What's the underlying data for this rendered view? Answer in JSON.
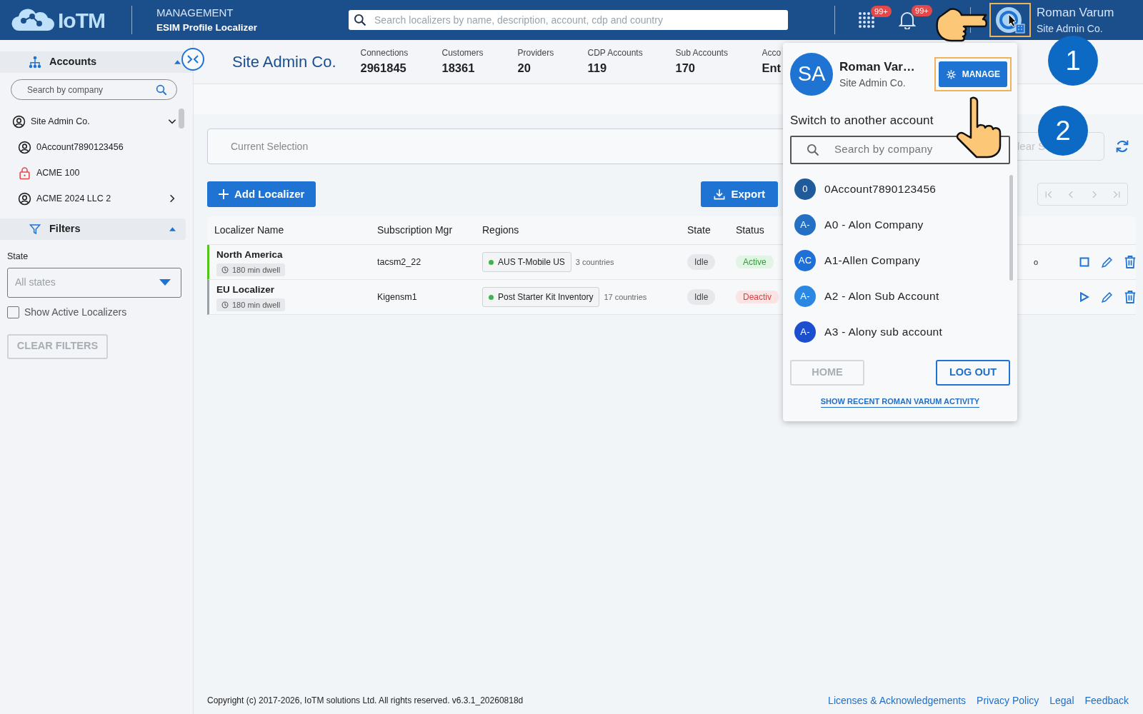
{
  "header": {
    "logo": "IoTM",
    "section": "MANAGEMENT",
    "page": "ESIM Profile Localizer",
    "search_placeholder": "Search localizers by name, description, account, cdp and country",
    "apps_badge": "99+",
    "notifications_badge": "99+",
    "user_name": "Roman Varum",
    "user_account": "Site Admin Co."
  },
  "sidebar": {
    "accounts_title": "Accounts",
    "accounts_expanded": true,
    "search_placeholder": "Search by company",
    "tree": [
      {
        "label": "Site Admin Co.",
        "kind": "account",
        "expanded": true,
        "children": [
          {
            "label": "0Account7890123456",
            "kind": "account"
          },
          {
            "label": "ACME 100",
            "kind": "locked"
          },
          {
            "label": "ACME 2024 LLC 2",
            "kind": "account",
            "expanded": false
          }
        ]
      }
    ],
    "filters_title": "Filters",
    "filters_expanded": true,
    "state_label": "State",
    "state_placeholder": "All states",
    "show_active": {
      "label": "Show Active Localizers",
      "checked": false
    },
    "clear_filters": {
      "label": "CLEAR FILTERS",
      "disabled": true
    }
  },
  "summary": {
    "title": "Site Admin Co.",
    "stats": [
      {
        "label": "Connections",
        "value": "2961845"
      },
      {
        "label": "Customers",
        "value": "18361"
      },
      {
        "label": "Providers",
        "value": "20"
      },
      {
        "label": "CDP Accounts",
        "value": "119"
      },
      {
        "label": "Sub Accounts",
        "value": "170"
      },
      {
        "label": "Acco",
        "value": "Ent"
      }
    ]
  },
  "selection": {
    "placeholder": "Current Selection",
    "clear_label": "lear S"
  },
  "toolbar": {
    "add": "Add Localizer",
    "export": "Export"
  },
  "table": {
    "columns": [
      "Localizer Name",
      "Subscription Mgr",
      "Regions",
      "State",
      "Status"
    ],
    "rows": [
      {
        "name": "North America",
        "dwell": "180 min dwell",
        "subscription_mgr": "tacsm2_22",
        "region": "AUS T-Mobile US",
        "region_count": "3 countries",
        "state": "Idle",
        "status": "Active",
        "active": true,
        "column_6": "o",
        "running": true
      },
      {
        "name": "EU Localizer",
        "dwell": "180 min dwell",
        "subscription_mgr": "Kigensm1",
        "region": "Post Starter Kit Inventory",
        "region_count": "17 countries",
        "state": "Idle",
        "status": "Deactiv",
        "active": false,
        "running": false
      }
    ]
  },
  "account_menu": {
    "initials": "SA",
    "name": "Roman Var…",
    "account": "Site Admin Co.",
    "manage": "MANAGE",
    "switch_title": "Switch to another account",
    "search_placeholder": "Search by company",
    "accounts": [
      {
        "initials": "0",
        "label": "0Account7890123456",
        "color": "#1f5a9a"
      },
      {
        "initials": "A-",
        "label": "A0 - Alon Company",
        "color": "#2370c4"
      },
      {
        "initials": "AC",
        "label": "A1-Allen Company",
        "color": "#1e6fd8"
      },
      {
        "initials": "A-",
        "label": "A2 - Alon Sub Account",
        "color": "#2a88e2"
      },
      {
        "initials": "A-",
        "label": "A3 - Alony sub account",
        "color": "#1c4fd0"
      }
    ],
    "home": {
      "label": "HOME",
      "disabled": true
    },
    "logout": "LOG OUT",
    "activity_link": "SHOW RECENT ROMAN VARUM ACTIVITY"
  },
  "steps": [
    {
      "label": "1"
    },
    {
      "label": "2"
    }
  ],
  "footer": {
    "copyright": "Copyright (c) 2017-2026, IoTM solutions Ltd. All rights reserved. v6.3.1_20260818d",
    "links": [
      "Licenses & Acknowledgements",
      "Privacy Policy",
      "Legal",
      "Feedback"
    ]
  }
}
